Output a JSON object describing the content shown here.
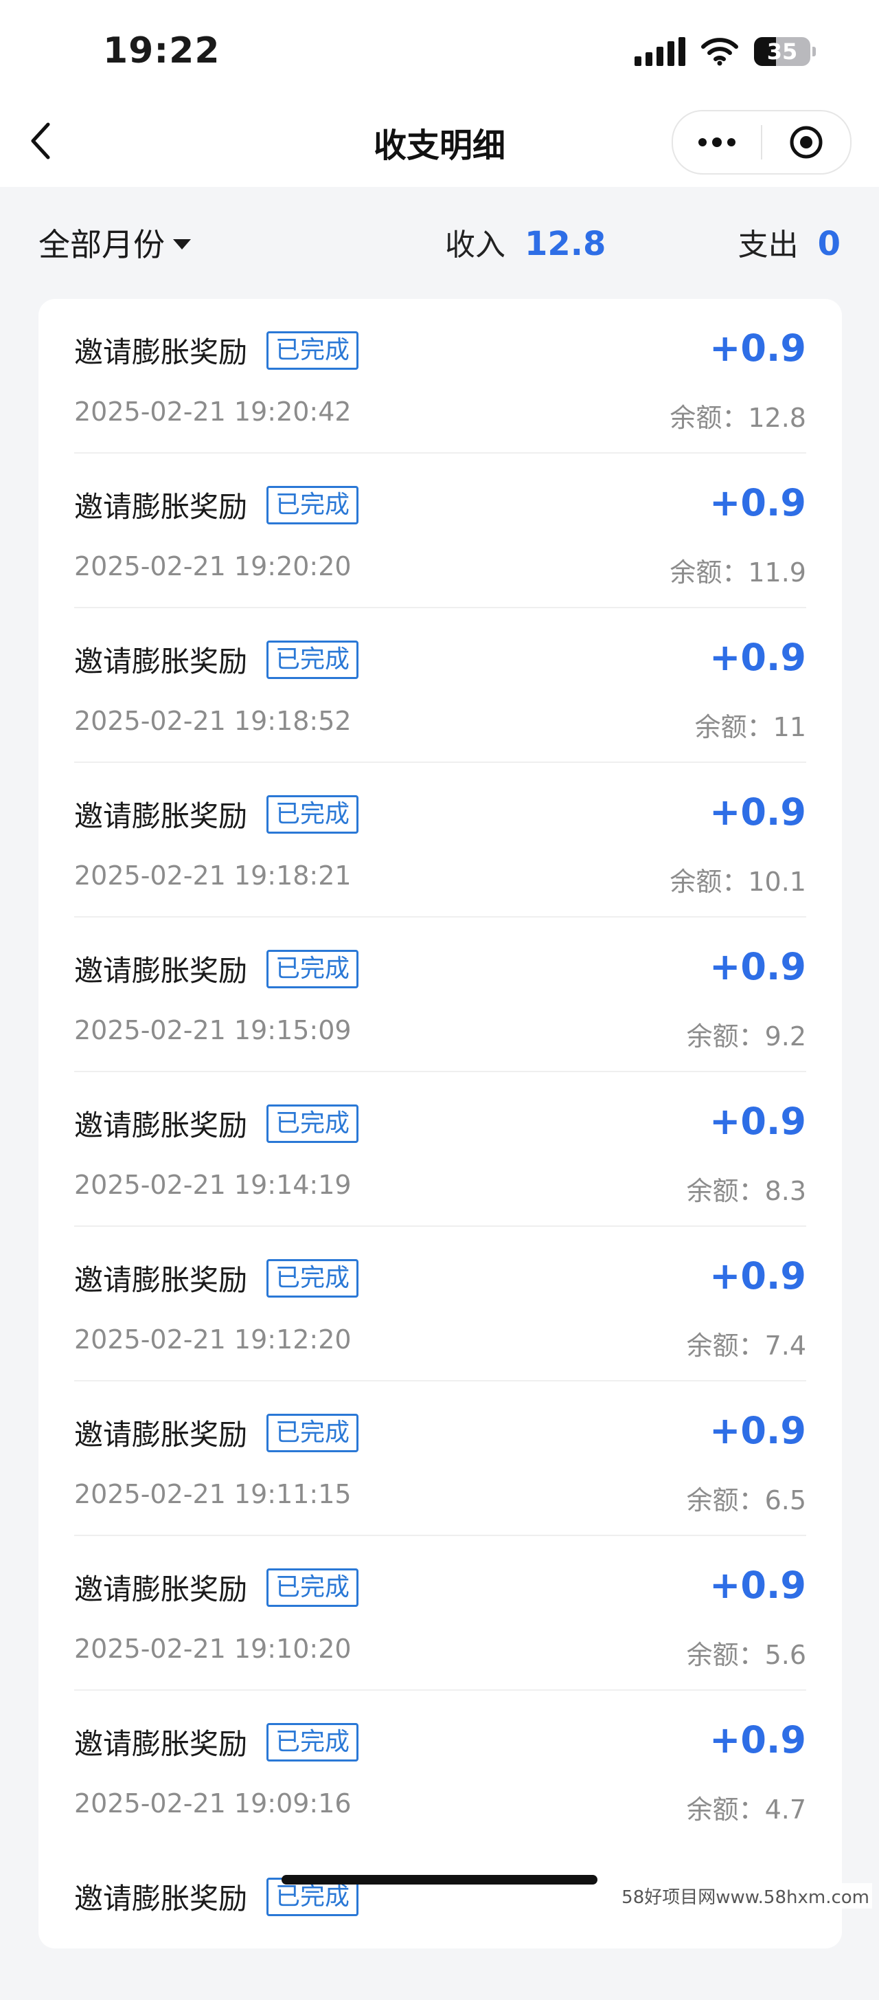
{
  "status_bar": {
    "time": "19:22",
    "battery": "35"
  },
  "nav": {
    "title": "收支明细"
  },
  "filter": {
    "month_label": "全部月份",
    "income_label": "收入",
    "income_value": "12.8",
    "expense_label": "支出",
    "expense_value": "0"
  },
  "records": [
    {
      "title": "邀请膨胀奖励",
      "status": "已完成",
      "amount": "+0.9",
      "time": "2025-02-21 19:20:42",
      "balance": "余额：12.8"
    },
    {
      "title": "邀请膨胀奖励",
      "status": "已完成",
      "amount": "+0.9",
      "time": "2025-02-21 19:20:20",
      "balance": "余额：11.9"
    },
    {
      "title": "邀请膨胀奖励",
      "status": "已完成",
      "amount": "+0.9",
      "time": "2025-02-21 19:18:52",
      "balance": "余额：11"
    },
    {
      "title": "邀请膨胀奖励",
      "status": "已完成",
      "amount": "+0.9",
      "time": "2025-02-21 19:18:21",
      "balance": "余额：10.1"
    },
    {
      "title": "邀请膨胀奖励",
      "status": "已完成",
      "amount": "+0.9",
      "time": "2025-02-21 19:15:09",
      "balance": "余额：9.2"
    },
    {
      "title": "邀请膨胀奖励",
      "status": "已完成",
      "amount": "+0.9",
      "time": "2025-02-21 19:14:19",
      "balance": "余额：8.3"
    },
    {
      "title": "邀请膨胀奖励",
      "status": "已完成",
      "amount": "+0.9",
      "time": "2025-02-21 19:12:20",
      "balance": "余额：7.4"
    },
    {
      "title": "邀请膨胀奖励",
      "status": "已完成",
      "amount": "+0.9",
      "time": "2025-02-21 19:11:15",
      "balance": "余额：6.5"
    },
    {
      "title": "邀请膨胀奖励",
      "status": "已完成",
      "amount": "+0.9",
      "time": "2025-02-21 19:10:20",
      "balance": "余额：5.6"
    },
    {
      "title": "邀请膨胀奖励",
      "status": "已完成",
      "amount": "+0.9",
      "time": "2025-02-21 19:09:16",
      "balance": "余额：4.7"
    },
    {
      "title": "邀请膨胀奖励",
      "status": "已完成",
      "amount": "",
      "time": "",
      "balance": ""
    }
  ],
  "watermark": "58好项目网www.58hxm.com",
  "colors": {
    "accent": "#2e6ee6",
    "badge": "#2a78d6",
    "muted": "#8c8c8c"
  },
  "icons": {
    "back": "chevron-left-icon",
    "more": "more-dots-icon",
    "close": "target-circle-icon"
  }
}
